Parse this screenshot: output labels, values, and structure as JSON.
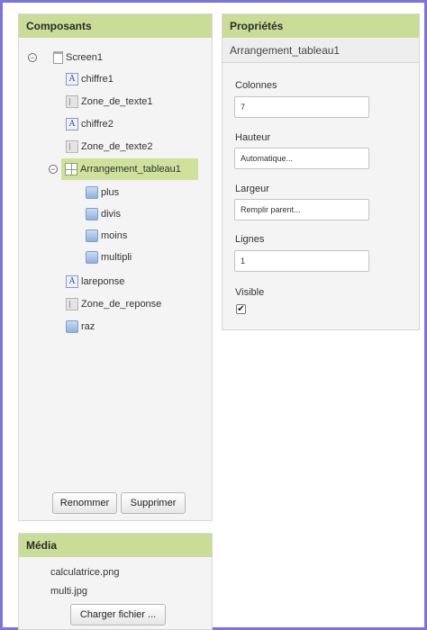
{
  "components": {
    "header": "Composants",
    "tree": [
      {
        "name": "Screen1",
        "icon": "screen-icon"
      },
      {
        "name": "chiffre1",
        "icon": "label-icon"
      },
      {
        "name": "Zone_de_texte1",
        "icon": "textbox-icon"
      },
      {
        "name": "chiffre2",
        "icon": "label-icon"
      },
      {
        "name": "Zone_de_texte2",
        "icon": "textbox-icon"
      },
      {
        "name": "Arrangement_tableau1",
        "icon": "table-arrangement-icon",
        "selected": true
      },
      {
        "name": "plus",
        "icon": "button-icon"
      },
      {
        "name": "divis",
        "icon": "button-icon"
      },
      {
        "name": "moins",
        "icon": "button-icon"
      },
      {
        "name": "multipli",
        "icon": "button-icon"
      },
      {
        "name": "lareponse",
        "icon": "label-icon"
      },
      {
        "name": "Zone_de_reponse",
        "icon": "textbox-icon"
      },
      {
        "name": "raz",
        "icon": "button-icon"
      }
    ],
    "rename_label": "Renommer",
    "delete_label": "Supprimer"
  },
  "properties": {
    "header": "Propriétés",
    "selected_component": "Arrangement_tableau1",
    "fields": {
      "columns": {
        "label": "Colonnes",
        "value": "7"
      },
      "height": {
        "label": "Hauteur",
        "value": "Automatique..."
      },
      "width": {
        "label": "Largeur",
        "value": "Remplir parent..."
      },
      "rows": {
        "label": "Lignes",
        "value": "1"
      }
    },
    "visible": {
      "label": "Visible",
      "checked": true,
      "mark": "✔"
    }
  },
  "media": {
    "header": "Média",
    "files": [
      "calculatrice.png",
      "multi.jpg"
    ],
    "upload_label": "Charger fichier ..."
  }
}
